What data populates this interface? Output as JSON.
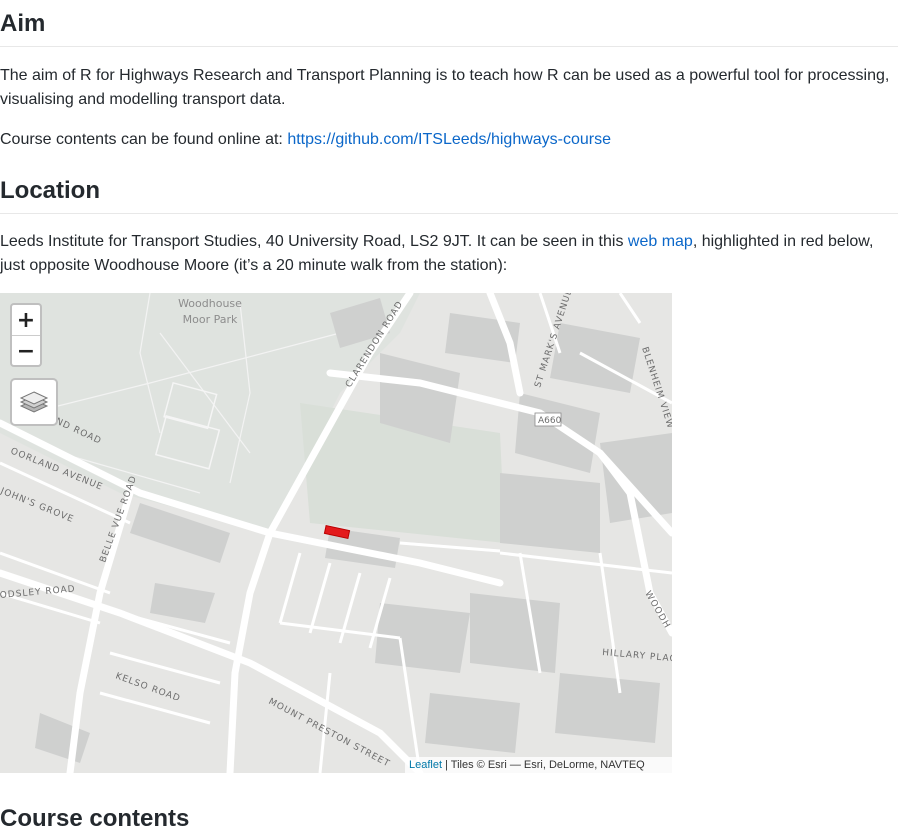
{
  "aim": {
    "heading": "Aim",
    "paragraph": "The aim of R for Highways Research and Transport Planning is to teach how R can be used as a powerful tool for processing, visualising and modelling transport data.",
    "course_prefix": "Course contents can be found online at: ",
    "course_link": "https://github.com/ITSLeeds/highways-course"
  },
  "location": {
    "heading": "Location",
    "text_before_link": "Leeds Institute for Transport Studies, 40 University Road, LS2 9JT. It can be seen in this ",
    "link": "web map",
    "text_after_link": ", highlighted in red below, just opposite Woodhouse Moore (it’s a 20 minute walk from the station):"
  },
  "map": {
    "zoom_in": "+",
    "zoom_out": "−",
    "layers_icon": "layers-icon",
    "labels": {
      "park_line1": "Woodhouse",
      "park_line2": "Moor Park",
      "clarendon": "CLARENDON ROAD",
      "st_marks": "ST MARK'S AVENUE",
      "blenheim": "BLENHEIM VIEW",
      "a660": "A660",
      "moorland_road": "ND ROAD",
      "moorland_avenue": "OORLAND AVENUE",
      "johns_grove": "JOHN'S GROVE",
      "belle_vue": "BELLE VUE ROAD",
      "woodsley": "ODSLEY ROAD",
      "kelso": "KELSO ROAD",
      "mount_preston": "MOUNT PRESTON STREET",
      "woodhouse_lane": "WOODH",
      "hillary": "HILLARY PLAC"
    },
    "highlight_color": "#e31a1c",
    "attribution_link": "Leaflet",
    "attribution_text": " | Tiles © Esri — Esri, DeLorme, NAVTEQ"
  },
  "course_contents": {
    "heading": "Course contents"
  }
}
